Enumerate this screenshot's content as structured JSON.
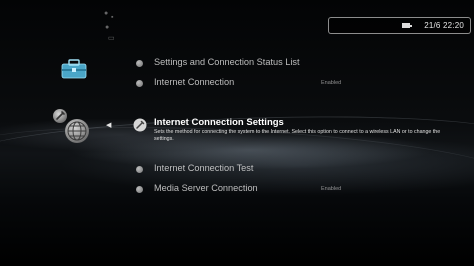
{
  "status": {
    "icon": "battery-icon",
    "datetime": "21/6 22:20"
  },
  "category": {
    "top_icon": "toolbox-icon",
    "current_icon": "network-settings-icon"
  },
  "menu": {
    "items": [
      {
        "label": "Settings and Connection Status List",
        "value": ""
      },
      {
        "label": "Internet Connection",
        "value": "Enabled"
      },
      {
        "label": "Internet Connection Settings",
        "description": "Sets the method for connecting the system to the Internet. Select this option to connect to a wireless LAN or to change the settings.",
        "selected": true
      },
      {
        "label": "Internet Connection Test",
        "value": ""
      },
      {
        "label": "Media Server Connection",
        "value": "Enabled"
      }
    ]
  }
}
